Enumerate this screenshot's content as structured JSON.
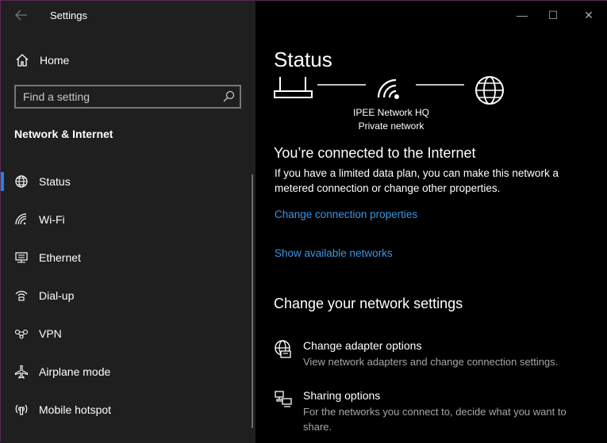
{
  "window": {
    "title": "Settings",
    "controls": {
      "minimize": "—",
      "maximize": "☐",
      "close": "✕"
    }
  },
  "sidebar": {
    "back_icon": "back-arrow-icon",
    "home_label": "Home",
    "search": {
      "placeholder": "Find a setting"
    },
    "section_title": "Network & Internet",
    "items": [
      {
        "label": "Status",
        "icon": "globe-icon",
        "active": true
      },
      {
        "label": "Wi-Fi",
        "icon": "wifi-icon",
        "active": false
      },
      {
        "label": "Ethernet",
        "icon": "ethernet-icon",
        "active": false
      },
      {
        "label": "Dial-up",
        "icon": "dialup-icon",
        "active": false
      },
      {
        "label": "VPN",
        "icon": "vpn-icon",
        "active": false
      },
      {
        "label": "Airplane mode",
        "icon": "airplane-icon",
        "active": false
      },
      {
        "label": "Mobile hotspot",
        "icon": "hotspot-icon",
        "active": false
      }
    ]
  },
  "main": {
    "title": "Status",
    "network": {
      "name": "IPEE Network HQ",
      "type": "Private network"
    },
    "connected_heading": "You’re connected to the Internet",
    "connected_text": "If you have a limited data plan, you can make this network a metered connection or change other properties.",
    "link_change_properties": "Change connection properties",
    "link_show_networks": "Show available networks",
    "settings_heading": "Change your network settings",
    "options": [
      {
        "title": "Change adapter options",
        "desc": "View network adapters and change connection settings.",
        "icon": "adapter-icon"
      },
      {
        "title": "Sharing options",
        "desc": "For the networks you connect to, decide what you want to share.",
        "icon": "sharing-icon"
      }
    ]
  },
  "colors": {
    "accent": "#2b7fd6",
    "link": "#3b95e6",
    "sidebar_bg": "#1f1f1f",
    "main_bg": "#000000"
  }
}
